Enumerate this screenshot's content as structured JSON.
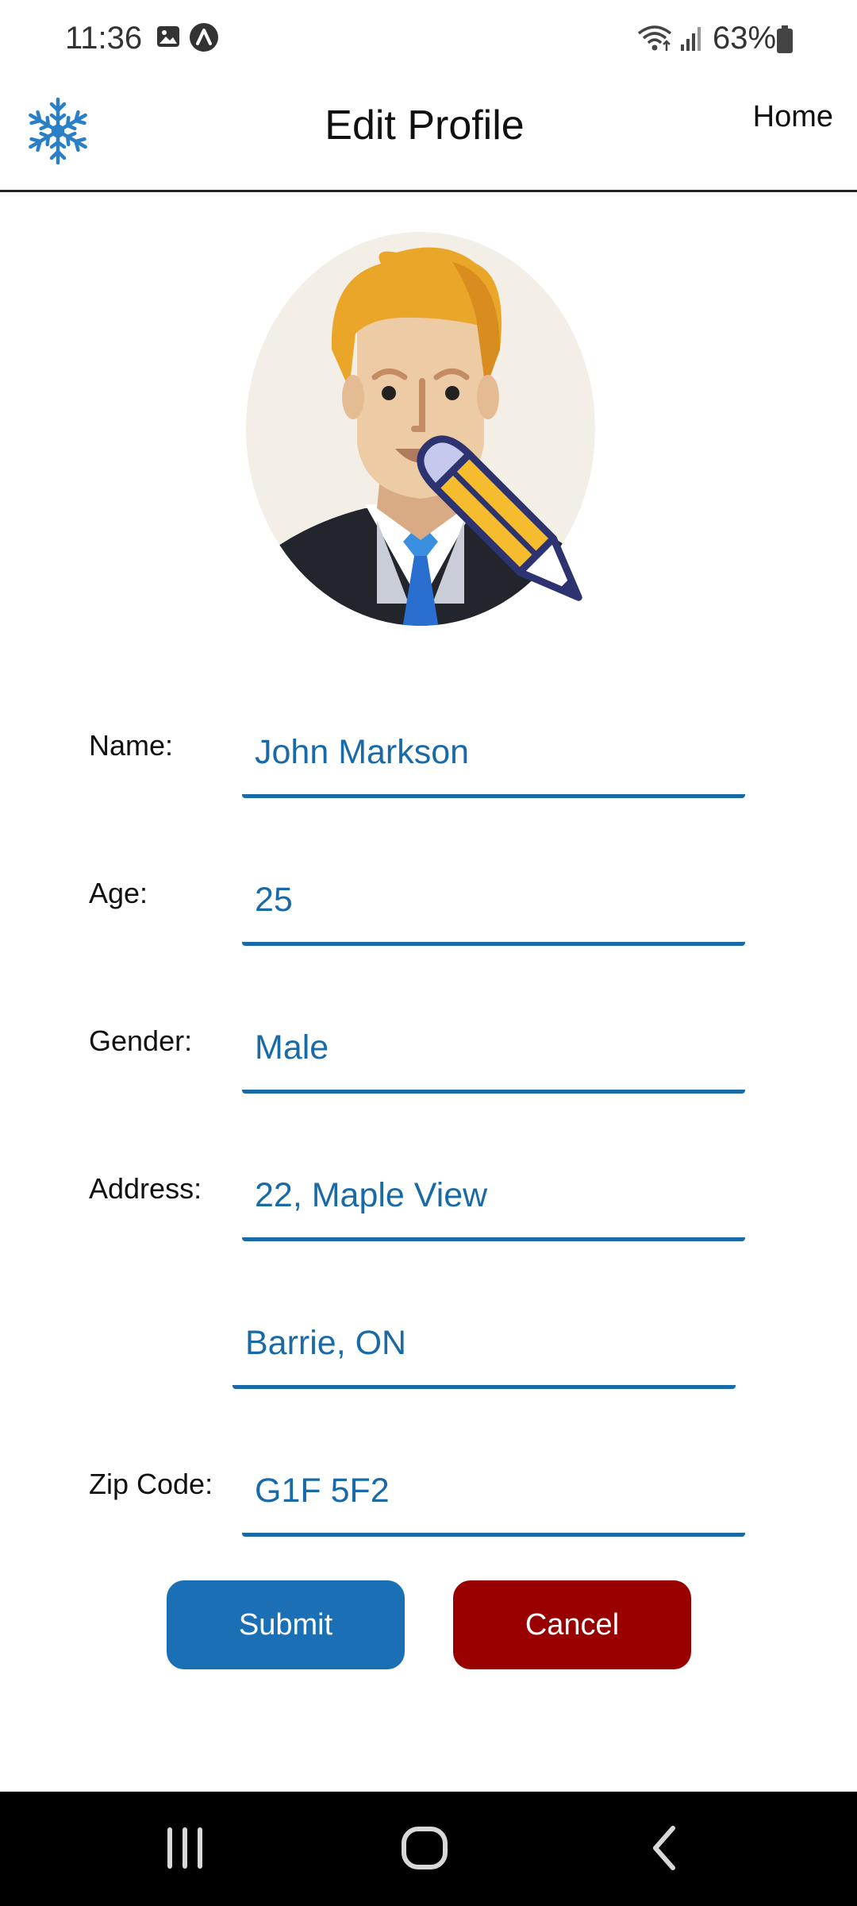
{
  "status_bar": {
    "time": "11:36",
    "battery": "63%",
    "icons": [
      "image-icon",
      "app-notification-icon",
      "wifi-icon",
      "signal-icon",
      "battery-icon"
    ]
  },
  "header": {
    "title": "Edit Profile",
    "home_link": "Home",
    "logo_icon": "snowflake-icon"
  },
  "avatar": {
    "icon": "profile-avatar-with-pencil-icon"
  },
  "form": {
    "name_label": "Name:",
    "name_value": "John Markson",
    "age_label": "Age:",
    "age_value": "25",
    "gender_label": "Gender:",
    "gender_value": "Male",
    "address_label": "Address:",
    "address_line1": "22, Maple View",
    "address_line2": "Barrie, ON",
    "zip_label": "Zip Code:",
    "zip_value": "G1F 5F2"
  },
  "buttons": {
    "submit": "Submit",
    "cancel": "Cancel"
  },
  "colors": {
    "accent": "#1a6aa8",
    "submit": "#1a6fb5",
    "cancel": "#990000"
  },
  "nav_bar": {
    "icons": [
      "recent-apps-icon",
      "home-icon",
      "back-icon"
    ]
  }
}
